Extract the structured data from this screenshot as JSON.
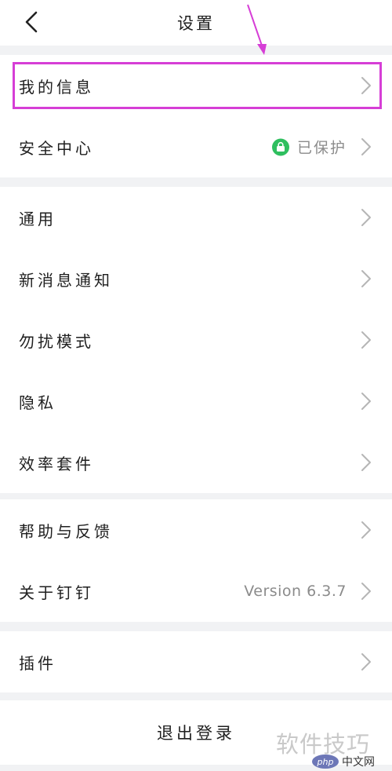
{
  "header": {
    "title": "设置",
    "back_icon": "chevron-left-icon"
  },
  "groups": [
    {
      "items": [
        {
          "label": "我的信息",
          "value": "",
          "highlighted": true
        },
        {
          "label": "安全中心",
          "value": "已保护",
          "value_icon": "lock-icon",
          "value_icon_color": "#2fbf5f"
        }
      ]
    },
    {
      "items": [
        {
          "label": "通用"
        },
        {
          "label": "新消息通知"
        },
        {
          "label": "勿扰模式"
        },
        {
          "label": "隐私"
        },
        {
          "label": "效率套件"
        }
      ]
    },
    {
      "items": [
        {
          "label": "帮助与反馈"
        },
        {
          "label": "关于钉钉",
          "value": "Version 6.3.7"
        }
      ]
    },
    {
      "items": [
        {
          "label": "插件"
        }
      ]
    }
  ],
  "logout": {
    "label": "退出登录"
  },
  "annotation": {
    "color": "#d63ed6"
  },
  "watermark": {
    "text": "软件技巧",
    "badge_logo": "php",
    "badge_text": "中文网"
  },
  "colors": {
    "background": "#f1f2f4",
    "surface": "#ffffff",
    "secondary_text": "#8b8b8b",
    "chevron": "#b5b5b5"
  }
}
